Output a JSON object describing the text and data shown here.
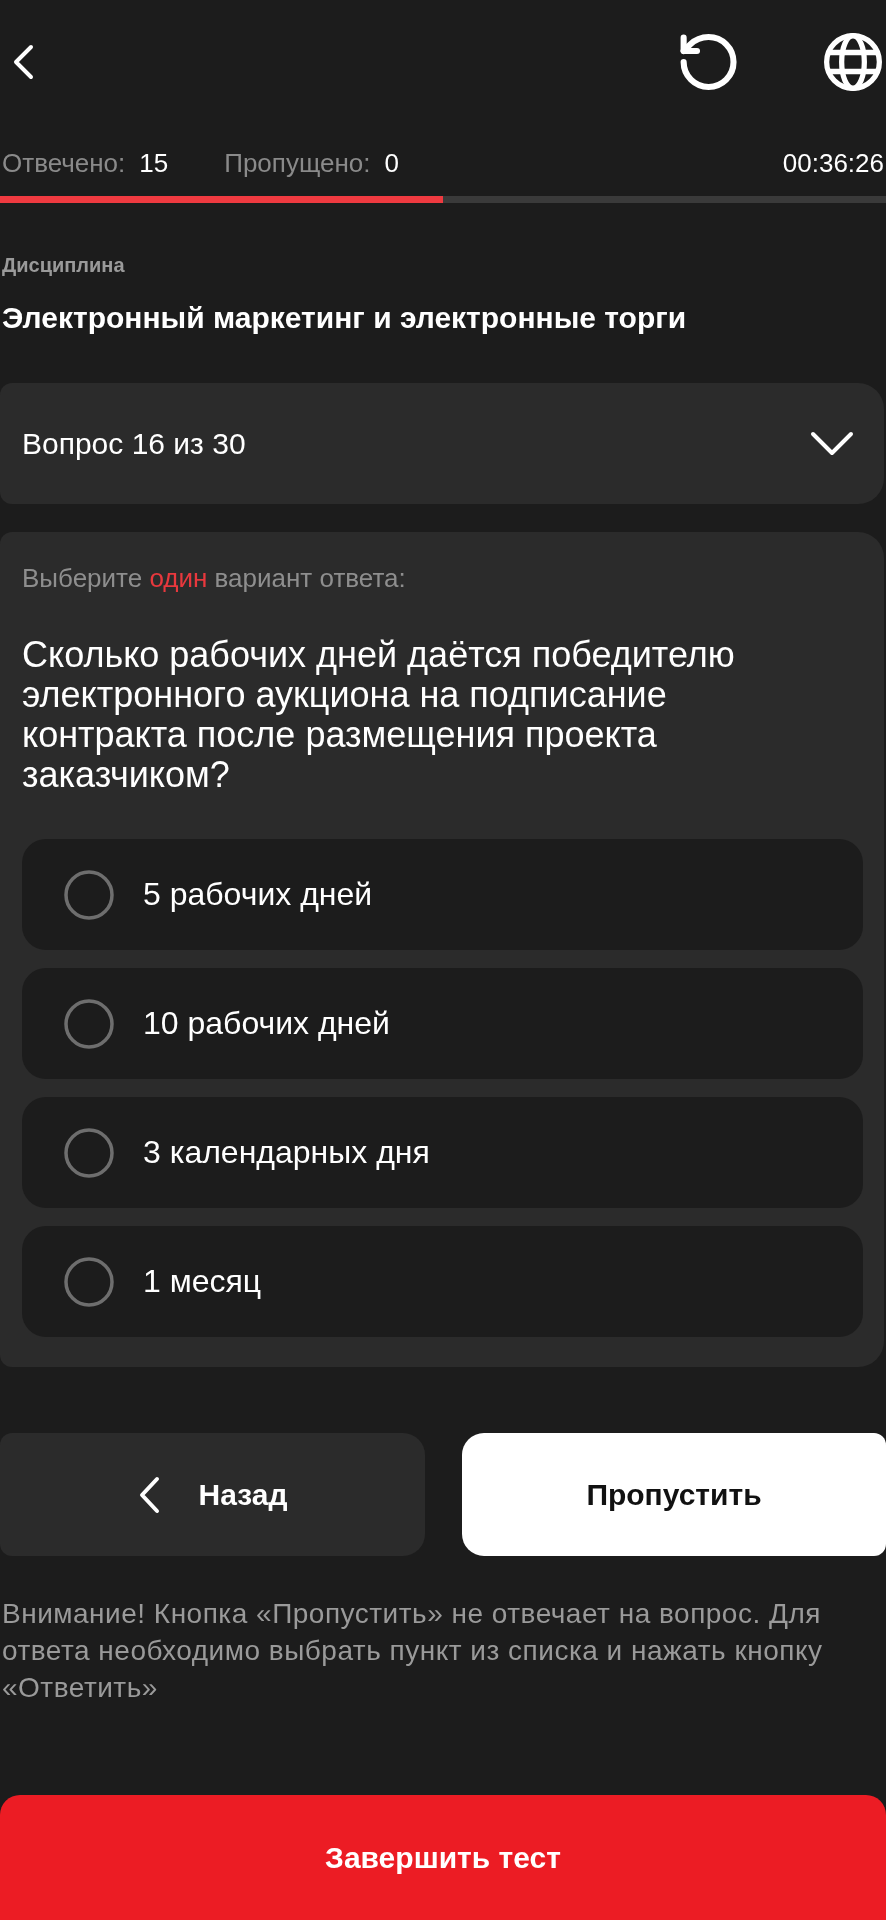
{
  "stats": {
    "answered": {
      "label": "Отвечено:",
      "value": "15"
    },
    "skipped": {
      "label": "Пропущено:",
      "value": "0"
    },
    "timer": "00:36:26"
  },
  "progress": {
    "level": 0.5
  },
  "discipline": {
    "label": "Дисциплина",
    "title": "Электронный маркетинг и электронные торги"
  },
  "question_selector": {
    "label": "Вопрос 16 из 30",
    "expanded": false
  },
  "question": {
    "instruction": {
      "before": "Выберите",
      "highlight": "один",
      "after": "вариант ответа:"
    },
    "text": "Сколько рабочих дней даётся победителю электронного аукциона на подписание контракта после размещения проекта заказчиком?",
    "options": [
      {
        "text": "5 рабочих дней",
        "selected": false
      },
      {
        "text": "10 рабочих дней",
        "selected": false
      },
      {
        "text": "3 календарных дня",
        "selected": false
      },
      {
        "text": "1 месяц",
        "selected": false
      }
    ]
  },
  "navigation": {
    "back_button": "Назад",
    "skip_button": "Пропустить"
  },
  "notice": "Внимание! Кнопка «Пропустить» не отвечает на вопрос. Для ответа необходимо выбрать пункт из списка и нажать кнопку «Ответить»",
  "finish_button": "Завершить тест"
}
